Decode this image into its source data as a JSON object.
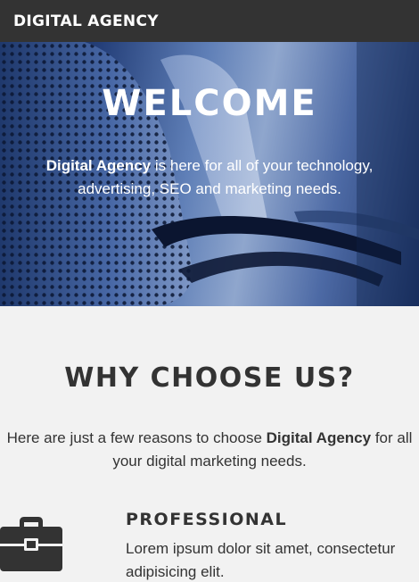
{
  "navbar": {
    "brand": "DIGITAL AGENCY"
  },
  "hero": {
    "title": "WELCOME",
    "text_brand": "Digital Agency",
    "text_rest": " is here for all of your technology, advertising, SEO and marketing needs."
  },
  "why": {
    "title": "WHY CHOOSE US?",
    "text_before": "Here are just a few reasons to choose ",
    "text_brand": "Digital Agency",
    "text_after": " for all your digital marketing needs."
  },
  "features": [
    {
      "icon": "briefcase-icon",
      "title": "PROFESSIONAL",
      "text": "Lorem ipsum dolor sit amet, consectetur adipisicing elit."
    }
  ]
}
